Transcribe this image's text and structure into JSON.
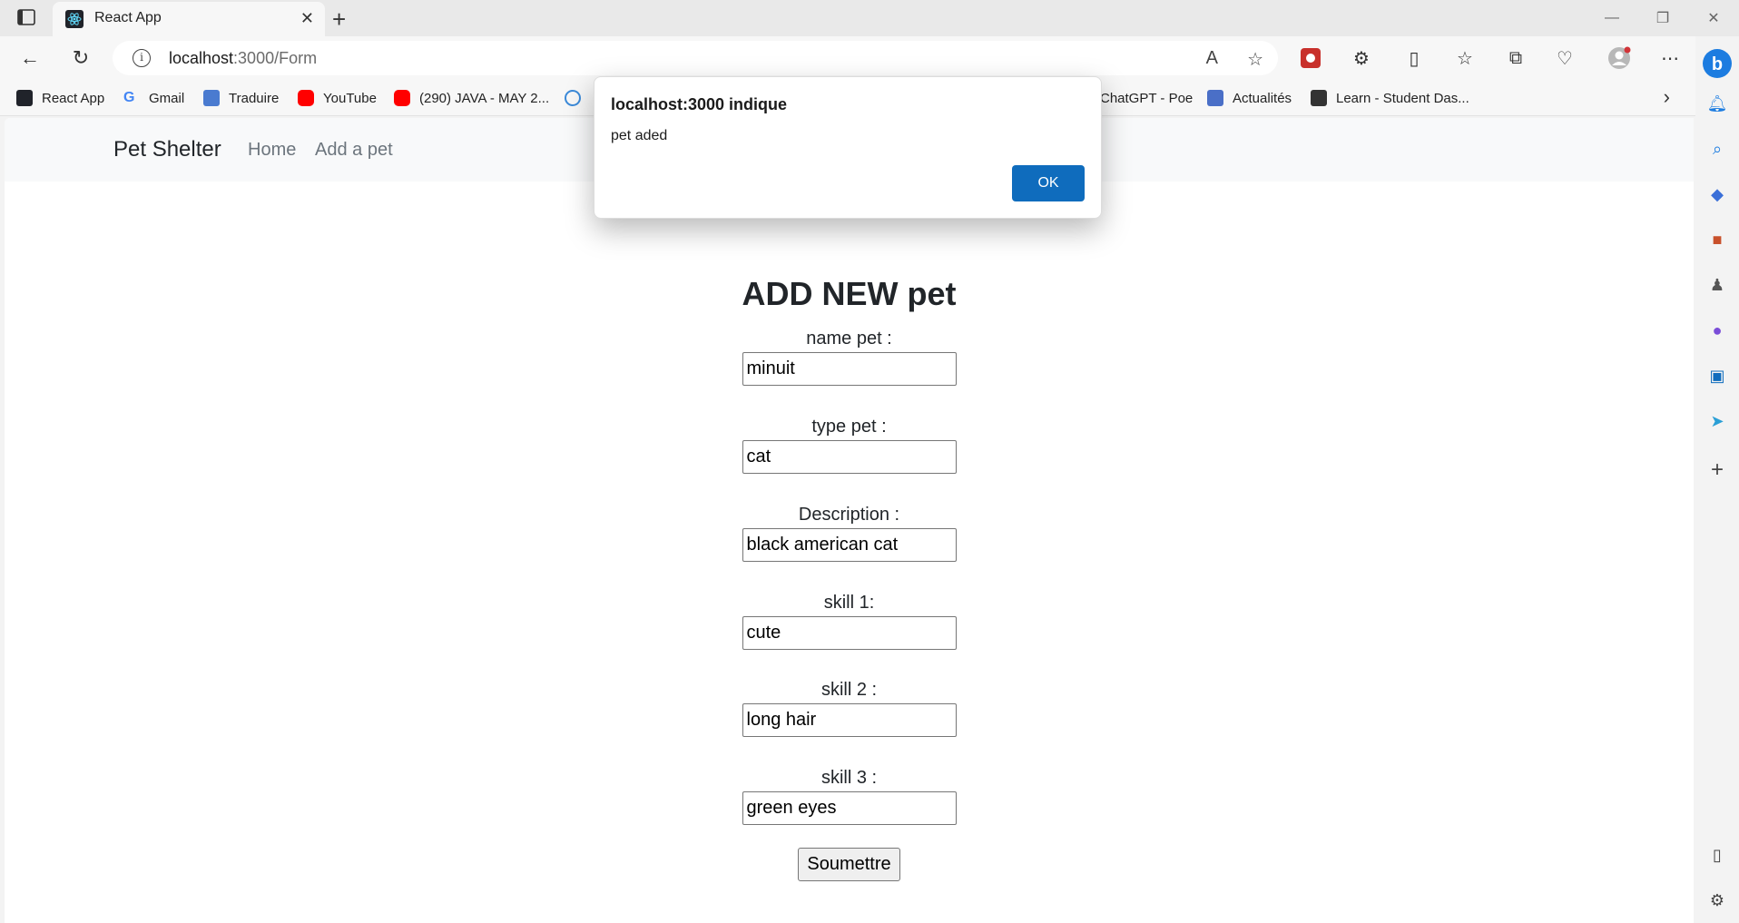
{
  "browser": {
    "tab_title": "React App",
    "url_host": "localhost",
    "url_path": ":3000/Form"
  },
  "favorites": [
    {
      "label": "React App",
      "icon": "react-icon",
      "color": "#222222"
    },
    {
      "label": "Gmail",
      "icon": "google-icon",
      "color": "#4285f4"
    },
    {
      "label": "Traduire",
      "icon": "translate-icon",
      "color": "#4a7bd0"
    },
    {
      "label": "YouTube",
      "icon": "youtube-icon",
      "color": "#ff0000"
    },
    {
      "label": "(290) JAVA - MAY 2...",
      "icon": "youtube-icon",
      "color": "#ff0000"
    },
    {
      "label": "",
      "icon": "react-icon",
      "color": "#3b8ad9"
    },
    {
      "label": "ChatGPT - Poe",
      "icon": "",
      "color": ""
    },
    {
      "label": "Actualités",
      "icon": "news-icon",
      "color": "#4a6fc7"
    },
    {
      "label": "Learn - Student Das...",
      "icon": "learn-icon",
      "color": "#333333"
    }
  ],
  "app": {
    "brand": "Pet Shelter",
    "nav": [
      "Home",
      "Add a pet"
    ]
  },
  "form": {
    "title": "ADD NEW pet",
    "fields": [
      {
        "label": "name pet :",
        "value": "minuit"
      },
      {
        "label": "type pet :",
        "value": "cat"
      },
      {
        "label": "Description :",
        "value": "black american cat"
      },
      {
        "label": "skill 1:",
        "value": "cute"
      },
      {
        "label": "skill 2 :",
        "value": "long hair"
      },
      {
        "label": "skill 3 :",
        "value": "green eyes"
      }
    ],
    "submit_label": "Soumettre"
  },
  "dialog": {
    "title": "localhost:3000 indique",
    "message": "pet aded",
    "ok_label": "OK"
  },
  "colors": {
    "accent": "#0f6cbd",
    "navbar_bg": "#f8f9fa"
  }
}
